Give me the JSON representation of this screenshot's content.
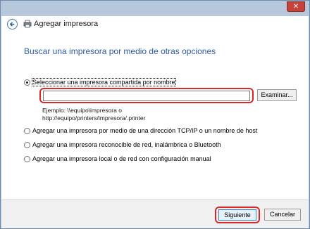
{
  "window": {
    "title": "Agregar impresora",
    "close_glyph": "✕"
  },
  "main": {
    "heading": "Buscar una impresora por medio de otras opciones",
    "options": [
      {
        "label": "Seleccionar una impresora compartida por nombre",
        "checked": true
      },
      {
        "label": "Agregar una impresora por medio de una dirección TCP/IP o un nombre de host",
        "checked": false
      },
      {
        "label": "Agregar una impresora reconocible de red, inalámbrica o Bluetooth",
        "checked": false
      },
      {
        "label": "Agregar una impresora local o de red con configuración manual",
        "checked": false
      }
    ],
    "name_input_value": "",
    "browse_label": "Examinar...",
    "example_line1": "Ejemplo: \\\\equipo\\impresora o",
    "example_line2": "http://equipo/printers/impresora/.printer"
  },
  "footer": {
    "next_label": "Siguiente",
    "cancel_label": "Cancelar"
  },
  "colors": {
    "heading": "#2a5aa0",
    "highlight": "#d9282b",
    "close": "#c7423a"
  },
  "icons": [
    "back-arrow-icon",
    "printer-icon",
    "close-icon"
  ]
}
